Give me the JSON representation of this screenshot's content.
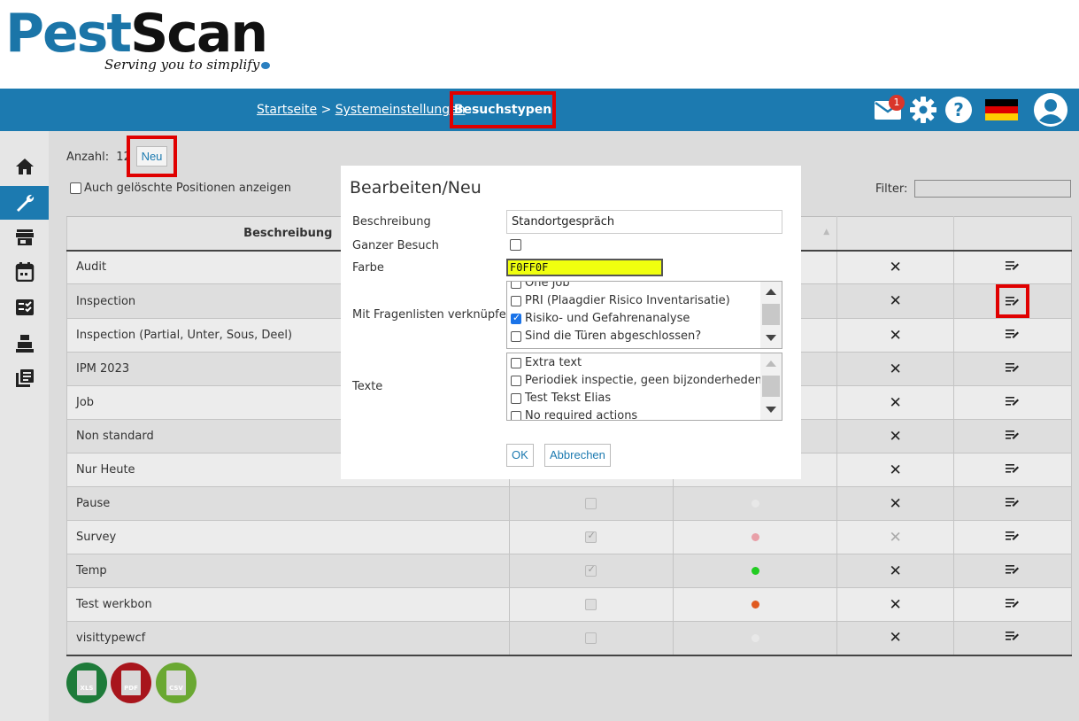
{
  "logo": {
    "part1": "Pest",
    "part2": "Scan",
    "tagline": "Serving you to simplify"
  },
  "breadcrumb": {
    "home": "Startseite",
    "sep": ">",
    "settings": "Systemeinstellungen",
    "current": "Besuchstypen"
  },
  "header": {
    "mail_badge": "1"
  },
  "toolbar": {
    "count_label": "Anzahl:",
    "count_value": "12",
    "new_label": "Neu",
    "show_deleted_label": "Auch gelöschte Positionen anzeigen",
    "filter_label": "Filter:"
  },
  "table": {
    "header_description": "Beschreibung",
    "rows": [
      {
        "name": "Audit"
      },
      {
        "name": "Inspection"
      },
      {
        "name": "Inspection (Partial, Unter, Sous, Deel)"
      },
      {
        "name": "IPM 2023"
      },
      {
        "name": "Job"
      },
      {
        "name": "Non standard"
      },
      {
        "name": "Nur Heute"
      },
      {
        "name": "Pause",
        "whole_visit": false,
        "color": "#e8e8e8"
      },
      {
        "name": "Survey",
        "whole_visit": true,
        "color": "#e8a0a8"
      },
      {
        "name": "Temp",
        "whole_visit": true,
        "color": "#22cc22"
      },
      {
        "name": "Test werkbon",
        "whole_visit": false,
        "color": "#e05a20"
      },
      {
        "name": "visittypewcf",
        "whole_visit": false,
        "color": "#e8e8e8"
      }
    ]
  },
  "exports": {
    "xls": "XLS",
    "pdf": "PDF",
    "csv": "CSV"
  },
  "modal": {
    "title": "Bearbeiten/Neu",
    "label_description": "Beschreibung",
    "value_description": "Standortgespräch",
    "label_whole_visit": "Ganzer Besuch",
    "label_color": "Farbe",
    "value_color": "F0FF0F",
    "label_questionnaires": "Mit Fragenlisten verknüpfen",
    "questionnaires": [
      {
        "label": "One Job",
        "checked": false
      },
      {
        "label": "PRI (Plaagdier Risico Inventarisatie)",
        "checked": false
      },
      {
        "label": "Risiko- und Gefahrenanalyse",
        "checked": true
      },
      {
        "label": "Sind die Türen abgeschlossen?",
        "checked": false
      }
    ],
    "label_texts": "Texte",
    "texts": [
      {
        "label": "Extra text",
        "checked": false
      },
      {
        "label": "Periodiek inspectie, geen bijzonderheden",
        "checked": false
      },
      {
        "label": "Test Tekst Elias",
        "checked": false
      },
      {
        "label": "No required actions",
        "checked": false
      }
    ],
    "ok_label": "OK",
    "cancel_label": "Abbrechen"
  },
  "colors": {
    "brand": "#1c7ab0",
    "highlight": "#e00000",
    "color_field": "#f0ff0f"
  }
}
